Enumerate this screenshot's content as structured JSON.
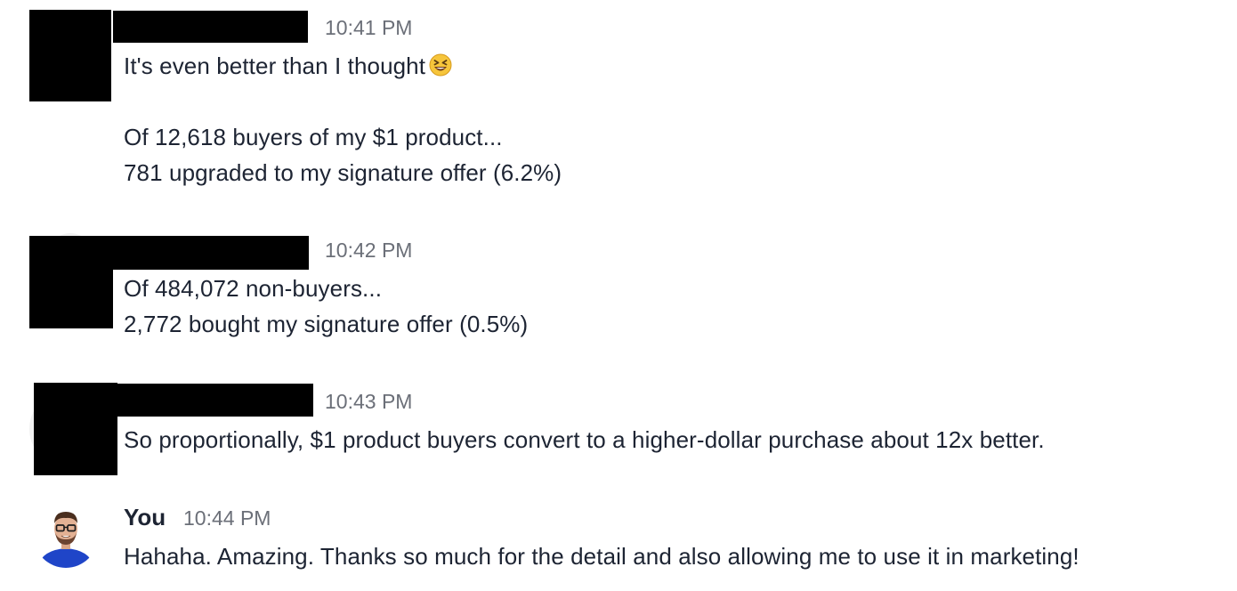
{
  "messages": [
    {
      "author": "",
      "time": "10:41 PM",
      "lines": [
        "It's even better than I thought",
        "Of 12,618 buyers of my $1 product...",
        "781 upgraded to my signature offer (6.2%)"
      ],
      "emoji_icon": "grinning-squinting-face-icon"
    },
    {
      "author": "",
      "time": "10:42 PM",
      "lines": [
        "Of 484,072 non-buyers...",
        "2,772 bought my signature offer (0.5%)"
      ]
    },
    {
      "author": "",
      "time": "10:43 PM",
      "lines": [
        "So proportionally, $1 product buyers convert to a higher-dollar purchase about 12x better."
      ]
    },
    {
      "author": "You",
      "time": "10:44 PM",
      "lines": [
        "Hahaha. Amazing. Thanks so much for the detail and also allowing me to use it in marketing!"
      ]
    }
  ],
  "colors": {
    "text": "#1d2433",
    "timestamp": "#6b6f78",
    "redaction": "#000000",
    "avatar_shirt": "#1f45c8"
  }
}
